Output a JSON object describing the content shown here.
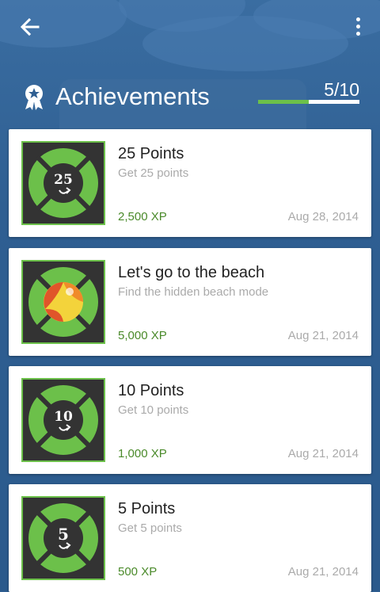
{
  "header": {
    "title": "Achievements",
    "count": "5/10",
    "progress": 0.5
  },
  "icons": {
    "back": "arrow-left-icon",
    "menu": "more-vertical-icon",
    "award": "award-icon"
  },
  "colors": {
    "accent": "#6cc04a",
    "background": "#2f5f92",
    "badge_dark": "#333333"
  },
  "achievements": [
    {
      "name": "25 Points",
      "description": "Get 25 points",
      "xp": "2,500 XP",
      "date": "Aug 28, 2014",
      "badge": "25"
    },
    {
      "name": "Let's go to the beach",
      "description": "Find the hidden beach mode",
      "xp": "5,000 XP",
      "date": "Aug 21, 2014",
      "badge": "beach-ball"
    },
    {
      "name": "10 Points",
      "description": "Get 10 points",
      "xp": "1,000 XP",
      "date": "Aug 21, 2014",
      "badge": "10"
    },
    {
      "name": "5 Points",
      "description": "Get 5 points",
      "xp": "500 XP",
      "date": "Aug 21, 2014",
      "badge": "5"
    }
  ]
}
